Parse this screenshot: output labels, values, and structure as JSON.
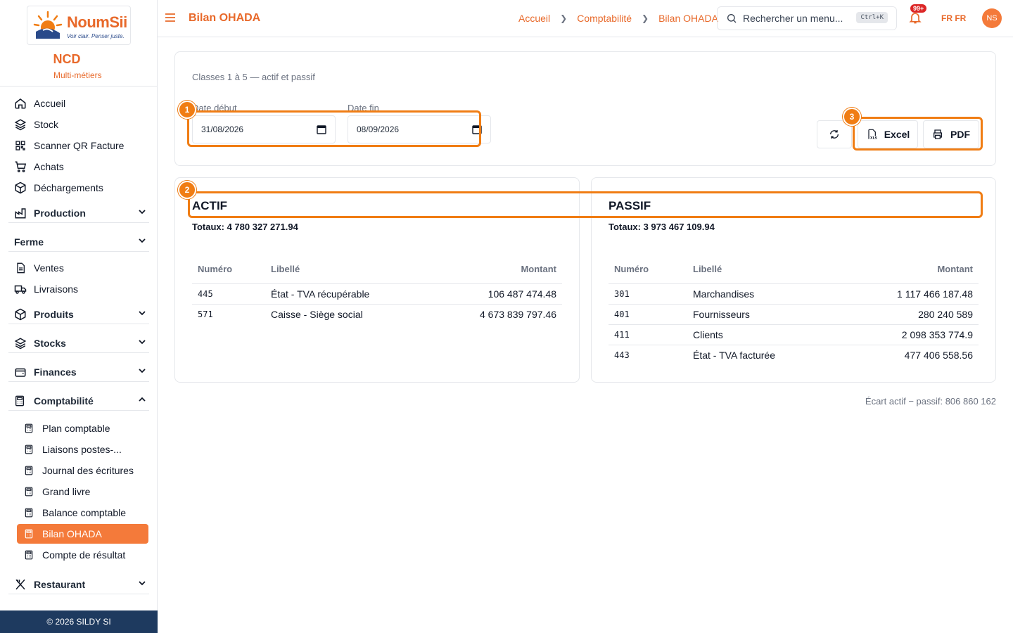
{
  "brand": {
    "logo_name": "NoumSii",
    "logo_tagline": "Voir clair. Penser juste.",
    "org_name": "NCD",
    "org_subtitle": "Multi-métiers"
  },
  "sidebar": {
    "items": [
      {
        "label": "Accueil",
        "icon": "home-icon"
      },
      {
        "label": "Stock",
        "icon": "layers-icon"
      },
      {
        "label": "Scanner QR Facture",
        "icon": "qr-icon"
      },
      {
        "label": "Achats",
        "icon": "cart-icon"
      },
      {
        "label": "Déchargements",
        "icon": "box-icon"
      },
      {
        "label": "Production",
        "icon": "factory-icon"
      },
      {
        "label": "Ferme"
      },
      {
        "label": "Ventes",
        "icon": "file-icon"
      },
      {
        "label": "Livraisons",
        "icon": "truck-icon"
      },
      {
        "label": "Produits",
        "icon": "box-icon"
      },
      {
        "label": "Stocks",
        "icon": "layers-icon"
      },
      {
        "label": "Finances",
        "icon": "wallet-icon"
      },
      {
        "label": "Comptabilité",
        "icon": "calculator-icon"
      },
      {
        "label": "Restaurant",
        "icon": "utensils-icon"
      }
    ],
    "compta_sub": [
      {
        "label": "Plan comptable"
      },
      {
        "label": "Liaisons postes-..."
      },
      {
        "label": "Journal des écritures"
      },
      {
        "label": "Grand livre"
      },
      {
        "label": "Balance comptable"
      },
      {
        "label": "Bilan OHADA"
      },
      {
        "label": "Compte de résultat"
      }
    ],
    "footer": "© 2026 SILDY SI"
  },
  "header": {
    "title": "Bilan OHADA",
    "breadcrumbs": [
      "Accueil",
      "Comptabilité",
      "Bilan OHADA"
    ],
    "search_placeholder": "Rechercher un menu...",
    "search_shortcut": "Ctrl+K",
    "notif_badge": "99+",
    "lang": "FR  FR",
    "avatar": "NS"
  },
  "filters": {
    "subtitle": "Classes 1 à 5 — actif et passif",
    "start_label": "Date début",
    "start_value": "31/08/2026",
    "end_label": "Date fin",
    "end_value": "08/09/2026",
    "excel_label": "Excel",
    "pdf_label": "PDF"
  },
  "annotations": [
    "1",
    "2",
    "3"
  ],
  "actif": {
    "title": "ACTIF",
    "totals": "Totaux: 4 780 327 271.94",
    "columns": [
      "Numéro",
      "Libellé",
      "Montant"
    ],
    "rows": [
      {
        "num": "445",
        "label": "État - TVA récupérable",
        "amount": "106 487 474.48"
      },
      {
        "num": "571",
        "label": "Caisse - Siège social",
        "amount": "4 673 839 797.46"
      }
    ]
  },
  "passif": {
    "title": "PASSIF",
    "totals": "Totaux: 3 973 467 109.94",
    "columns": [
      "Numéro",
      "Libellé",
      "Montant"
    ],
    "rows": [
      {
        "num": "301",
        "label": "Marchandises",
        "amount": "1 117 466 187.48"
      },
      {
        "num": "401",
        "label": "Fournisseurs",
        "amount": "280 240 589"
      },
      {
        "num": "411",
        "label": "Clients",
        "amount": "2 098 353 774.9"
      },
      {
        "num": "443",
        "label": "État - TVA facturée",
        "amount": "477 406 558.56"
      }
    ]
  },
  "ecart": "Écart actif − passif: 806 860 162",
  "colors": {
    "accent": "#e8692a",
    "active_bg": "#f47a3a",
    "annotation": "#f07d14",
    "footer_bg": "#1e3a5f"
  }
}
